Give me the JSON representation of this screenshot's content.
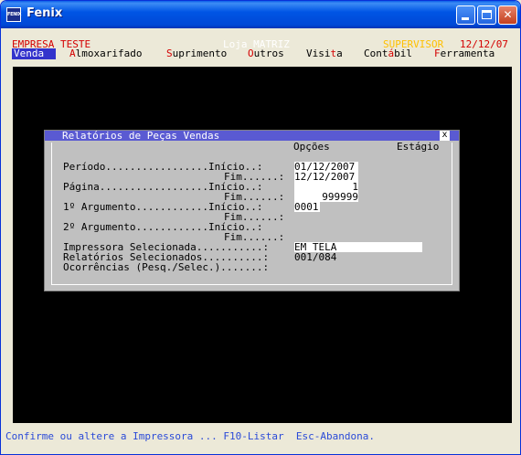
{
  "window": {
    "title": "Fenix",
    "icon_text": "FENIX"
  },
  "header": {
    "empresa": "EMPRESA TESTE",
    "loja": "Loja MATRIZ",
    "supervisor": "SUPERVISOR",
    "date": "12/12/07"
  },
  "menu": [
    {
      "hotkey": "V",
      "rest": "enda"
    },
    {
      "hotkey": "A",
      "rest": "lmoxarifado"
    },
    {
      "hotkey": "S",
      "rest": "uprimento"
    },
    {
      "hotkey": "O",
      "rest": "utros"
    },
    {
      "pre": "Visi",
      "hotkey": "t",
      "rest": "a"
    },
    {
      "pre": "Cont",
      "hotkey": "á",
      "rest": "bil"
    },
    {
      "hotkey": "F",
      "rest": "erramenta"
    }
  ],
  "dialog": {
    "title": "Relatórios de Peças Vendas",
    "close": "x",
    "col_opcoes": "Opções",
    "col_estagio": "Estágio",
    "rows": {
      "periodo_label": "Período.................Início..:",
      "periodo_inicio": "01/12/2007",
      "periodo_fim_label": "Fim......:",
      "periodo_fim": "12/12/2007",
      "pagina_label": "Página..................Início..:",
      "pagina_inicio": "1",
      "pagina_fim_label": "Fim......:",
      "pagina_fim": "999999",
      "arg1_label": "1º Argumento............Início..:",
      "arg1_inicio": "0001",
      "arg1_fim_label": "Fim......:",
      "arg2_label": "2º Argumento............Início..:",
      "arg2_fim_label": "Fim......:",
      "impressora_label": "Impressora Selecionada...........:",
      "impressora_value": "EM TELA",
      "relatorios_label": "Relatórios Selecionados..........:",
      "relatorios_value": "001/084",
      "ocorrencias_label": "Ocorrências (Pesq./Selec.).......:"
    }
  },
  "status_bar": "Confirme ou altere a Impressora ... F10-Listar  Esc-Abandona."
}
